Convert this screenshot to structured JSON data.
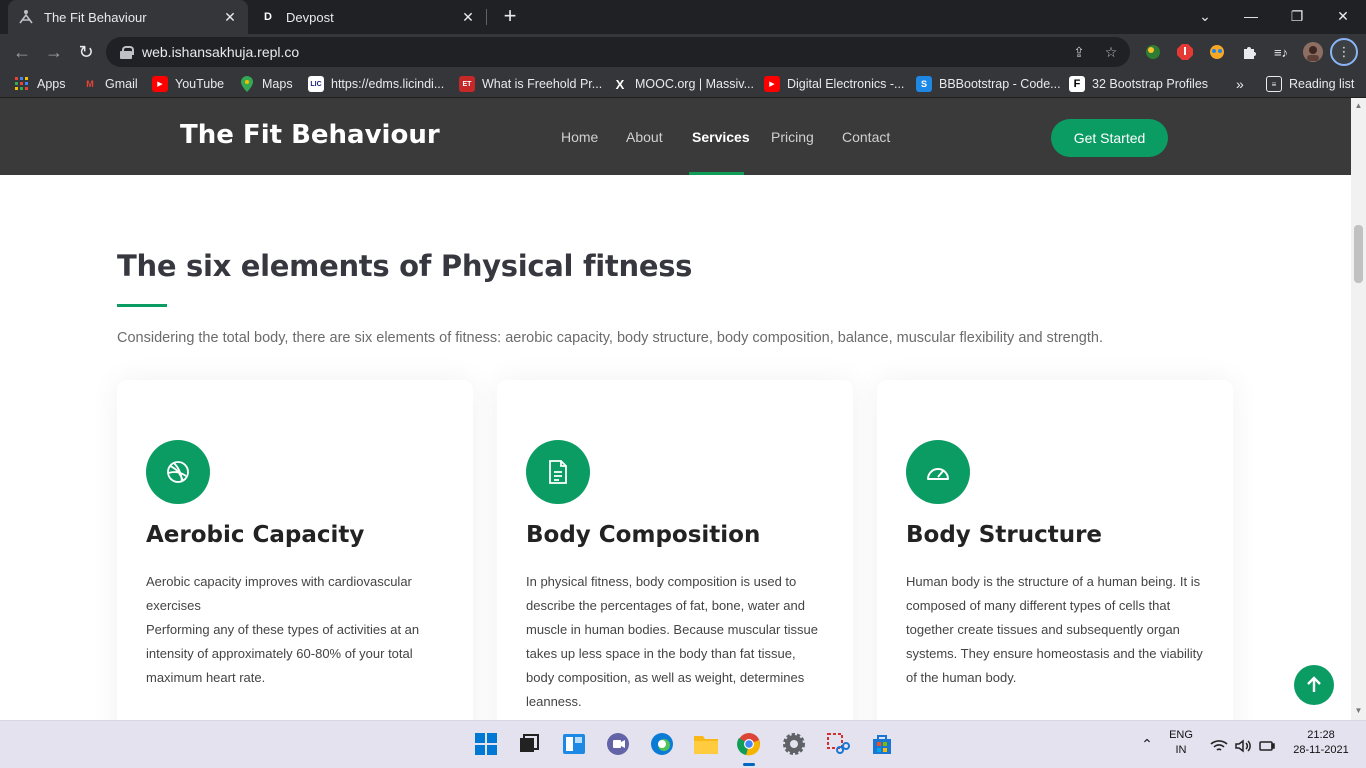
{
  "browser": {
    "tabs": [
      {
        "title": "The Fit Behaviour",
        "favicon": "yoga-icon",
        "active": true
      },
      {
        "title": "Devpost",
        "favicon": "D",
        "active": false
      }
    ],
    "url": "web.ishansakhuja.repl.co",
    "bookmarks": [
      {
        "label": "Apps",
        "icon": "apps-grid-icon"
      },
      {
        "label": "Gmail",
        "icon": "gmail-icon"
      },
      {
        "label": "YouTube",
        "icon": "youtube-icon"
      },
      {
        "label": "Maps",
        "icon": "maps-icon"
      },
      {
        "label": "https://edms.licindi...",
        "icon": "lic-icon"
      },
      {
        "label": "What is Freehold Pr...",
        "icon": "et-icon"
      },
      {
        "label": "MOOC.org | Massiv...",
        "icon": "x-icon"
      },
      {
        "label": "Digital Electronics -...",
        "icon": "youtube-icon"
      },
      {
        "label": "BBBootstrap - Code...",
        "icon": "bbbootstrap-icon"
      },
      {
        "label": "32 Bootstrap Profiles",
        "icon": "f-icon"
      }
    ],
    "reading_list": "Reading list",
    "overflow": "»"
  },
  "site": {
    "brand": "The Fit Behaviour",
    "nav": [
      "Home",
      "About",
      "Services",
      "Pricing",
      "Contact"
    ],
    "active_nav": "Services",
    "cta": "Get Started",
    "accent_color": "#0b9c64",
    "header_color": "#3a3a3a"
  },
  "section": {
    "title": "The six elements of Physical fitness",
    "description": "Considering the total body, there are six elements of fitness: aerobic capacity, body structure, body composition, balance, muscular flexibility and strength.",
    "cards": [
      {
        "icon": "dribbble-icon",
        "title": "Aerobic Capacity",
        "lines": [
          "Aerobic capacity improves with cardiovascular exercises",
          "Performing any of these types of activities at an intensity of approximately 60-80% of your total maximum heart rate."
        ]
      },
      {
        "icon": "document-icon",
        "title": "Body Composition",
        "lines": [
          "In physical fitness, body composition is used to describe the percentages of fat, bone, water and muscle in human bodies. Because muscular tissue takes up less space in the body than fat tissue, body composition, as well as weight, determines leanness."
        ]
      },
      {
        "icon": "speedometer-icon",
        "title": "Body Structure",
        "lines": [
          "Human body is the structure of a human being. It is composed of many different types of cells that together create tissues and subsequently organ systems. They ensure homeostasis and the viability of the human body."
        ]
      }
    ]
  },
  "taskbar": {
    "language": "ENG",
    "region": "IN",
    "time": "21:28",
    "date": "28-11-2021"
  }
}
